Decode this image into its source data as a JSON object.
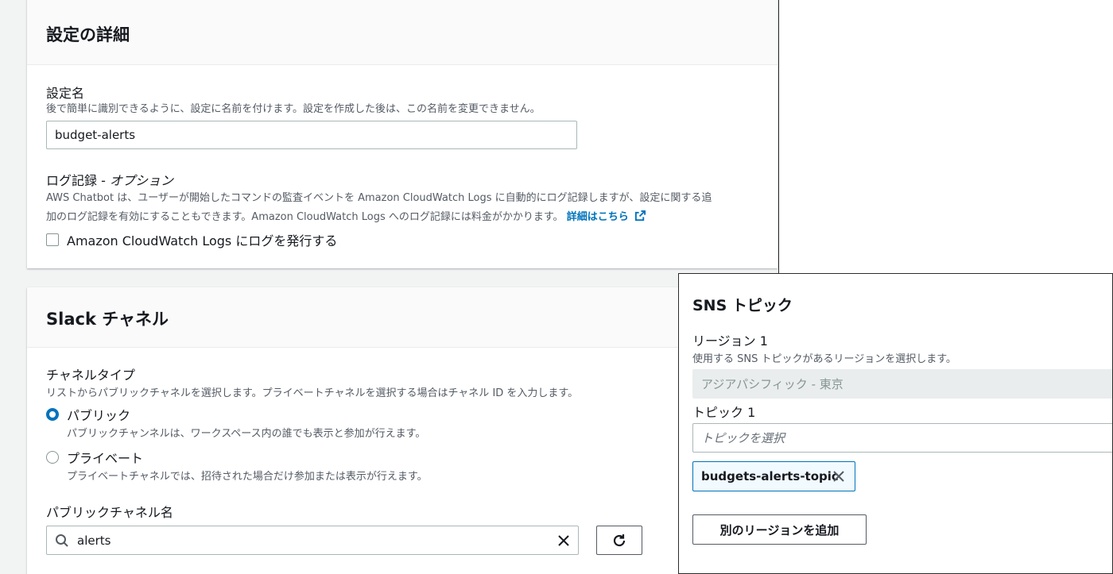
{
  "config_details": {
    "title": "設定の詳細",
    "config_name": {
      "label": "設定名",
      "description": "後で簡単に識別できるように、設定に名前を付けます。設定を作成した後は、この名前を変更できません。",
      "value": "budget-alerts"
    },
    "logging": {
      "label": "ログ記録 - ",
      "label_optional": "オプション",
      "description_line1": "AWS Chatbot は、ユーザーが開始したコマンドの監査イベントを Amazon CloudWatch Logs に自動的にログ記録しますが、設定に関する追",
      "description_line2": "加のログ記録を有効にすることもできます。Amazon CloudWatch Logs へのログ記録には料金がかかります。",
      "learn_more": "詳細はこちら",
      "checkbox_label": "Amazon CloudWatch Logs にログを発行する",
      "checkbox_checked": false
    }
  },
  "slack_channel": {
    "title": "Slack チャネル",
    "channel_type": {
      "label": "チャネルタイプ",
      "description": "リストからパブリックチャネルを選択します。プライベートチャネルを選択する場合はチャネル ID を入力します。",
      "options": [
        {
          "label": "パブリック",
          "description": "パブリックチャンネルは、ワークスペース内の誰でも表示と参加が行えます。",
          "selected": true
        },
        {
          "label": "プライベート",
          "description": "プライベートチャネルでは、招待された場合だけ参加または表示が行えます。",
          "selected": false
        }
      ]
    },
    "public_channel_name": {
      "label": "パブリックチャネル名",
      "value": "alerts"
    }
  },
  "sns_topics": {
    "title": "SNS トピック",
    "region_label": "リージョン 1",
    "region_description": "使用する SNS トピックがあるリージョンを選択します。",
    "region_value": "アジアパシフィック - 東京",
    "topic_label": "トピック 1",
    "topic_placeholder": "トピックを選択",
    "selected_topic": "budgets-alerts-topic",
    "add_region_button": "別のリージョンを追加"
  },
  "colors": {
    "accent": "#0073bb",
    "text": "#16191f",
    "secondary_text": "#545b64",
    "panel_header": "#fafafa",
    "page_background": "#f2f3f3"
  }
}
